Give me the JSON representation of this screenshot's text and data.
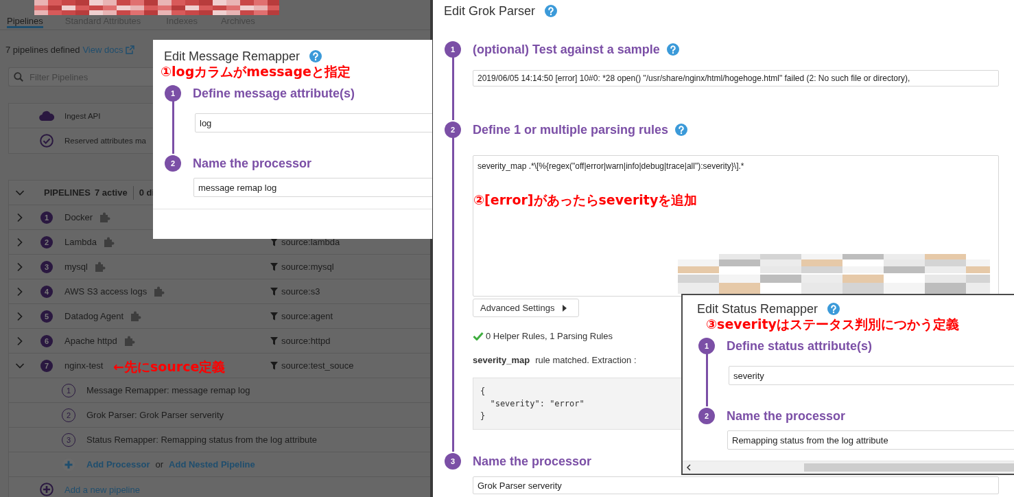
{
  "pipelines_page": {
    "tabs": [
      {
        "label": "Pipelines",
        "selected": true
      },
      {
        "label": "Standard Attributes",
        "selected": false
      },
      {
        "label": "Indexes",
        "selected": false
      },
      {
        "label": "Archives",
        "selected": false
      }
    ],
    "summary": "7 pipelines defined",
    "docs_link": "View docs",
    "filter": {
      "placeholder": "Filter Pipelines"
    },
    "sources": [
      {
        "kind": "cloud",
        "label": "Ingest API"
      },
      {
        "kind": "check",
        "label": "Reserved attributes ma"
      }
    ],
    "header": {
      "title": "PIPELINES",
      "active": "7 active",
      "disabled": "0 di"
    },
    "pipelines": [
      {
        "number": "1",
        "name": "Docker",
        "expanded": false,
        "integration": true
      },
      {
        "number": "2",
        "name": "Lambda",
        "expanded": false,
        "integration": true,
        "filter": "source:lambda"
      },
      {
        "number": "3",
        "name": "mysql",
        "expanded": false,
        "integration": true,
        "filter": "source:mysql"
      },
      {
        "number": "4",
        "name": "AWS S3 access logs",
        "expanded": false,
        "integration": true,
        "filter": "source:s3"
      },
      {
        "number": "5",
        "name": "Datadog Agent",
        "expanded": false,
        "integration": true,
        "filter": "source:agent"
      },
      {
        "number": "6",
        "name": "Apache httpd",
        "expanded": false,
        "integration": true,
        "filter": "source:httpd"
      },
      {
        "number": "7",
        "name": "nginx-test",
        "expanded": true,
        "integration": false,
        "filter": "source:test_souce",
        "processors": [
          {
            "number": "1",
            "label": "Message Remapper: message remap log"
          },
          {
            "number": "2",
            "label": "Grok Parser: Grok Parser serverity"
          },
          {
            "number": "3",
            "label": "Status Remapper: Remapping status from the log attribute"
          }
        ],
        "add_processor": "Add Processor",
        "add_separator": "or",
        "add_nested": "Add Nested Pipeline"
      }
    ],
    "add_pipeline": "Add a new pipeline",
    "note": "←先にsource定義"
  },
  "message_remapper": {
    "title": "Edit Message Remapper",
    "note": "①logカラムがmessageと指定",
    "steps": [
      {
        "number": "1",
        "title": "Define message attribute(s)",
        "value": "log"
      },
      {
        "number": "2",
        "title": "Name the processor",
        "value": "message remap log"
      }
    ]
  },
  "grok_parser": {
    "title": "Edit Grok Parser",
    "note": "②[error]があったらseverityを追加",
    "steps": [
      {
        "kind": "sample",
        "number": "1",
        "title": "(optional) Test against a sample",
        "help": true,
        "value": "2019/06/05 14:14:50 [error] 10#0: *28 open() \"/usr/share/nginx/html/hogehoge.html\" failed (2: No such file or directory),"
      },
      {
        "kind": "rules",
        "number": "2",
        "title": "Define 1 or multiple parsing rules",
        "help": true,
        "value": "severity_map .*\\[%{regex(\"off|error|warn|info|debug|trace|all\"):severity}\\].*",
        "advanced": "Advanced Settings",
        "valid": true,
        "status": "0 Helper Rules, 1 Parsing Rules",
        "matched_rule": "severity_map",
        "matched_text": "rule matched. Extraction :",
        "extraction": "{\n  \"severity\": \"error\"\n}"
      },
      {
        "kind": "name",
        "number": "3",
        "title": "Name the processor",
        "help": false,
        "value": "Grok Parser serverity"
      }
    ]
  },
  "status_remapper": {
    "title": "Edit Status Remapper",
    "note": "③severityはステータス判別につかう定義",
    "steps": [
      {
        "number": "1",
        "title": "Define status attribute(s)",
        "value": "severity"
      },
      {
        "number": "2",
        "title": "Name the processor",
        "value": "Remapping status from the log attribute"
      }
    ]
  }
}
